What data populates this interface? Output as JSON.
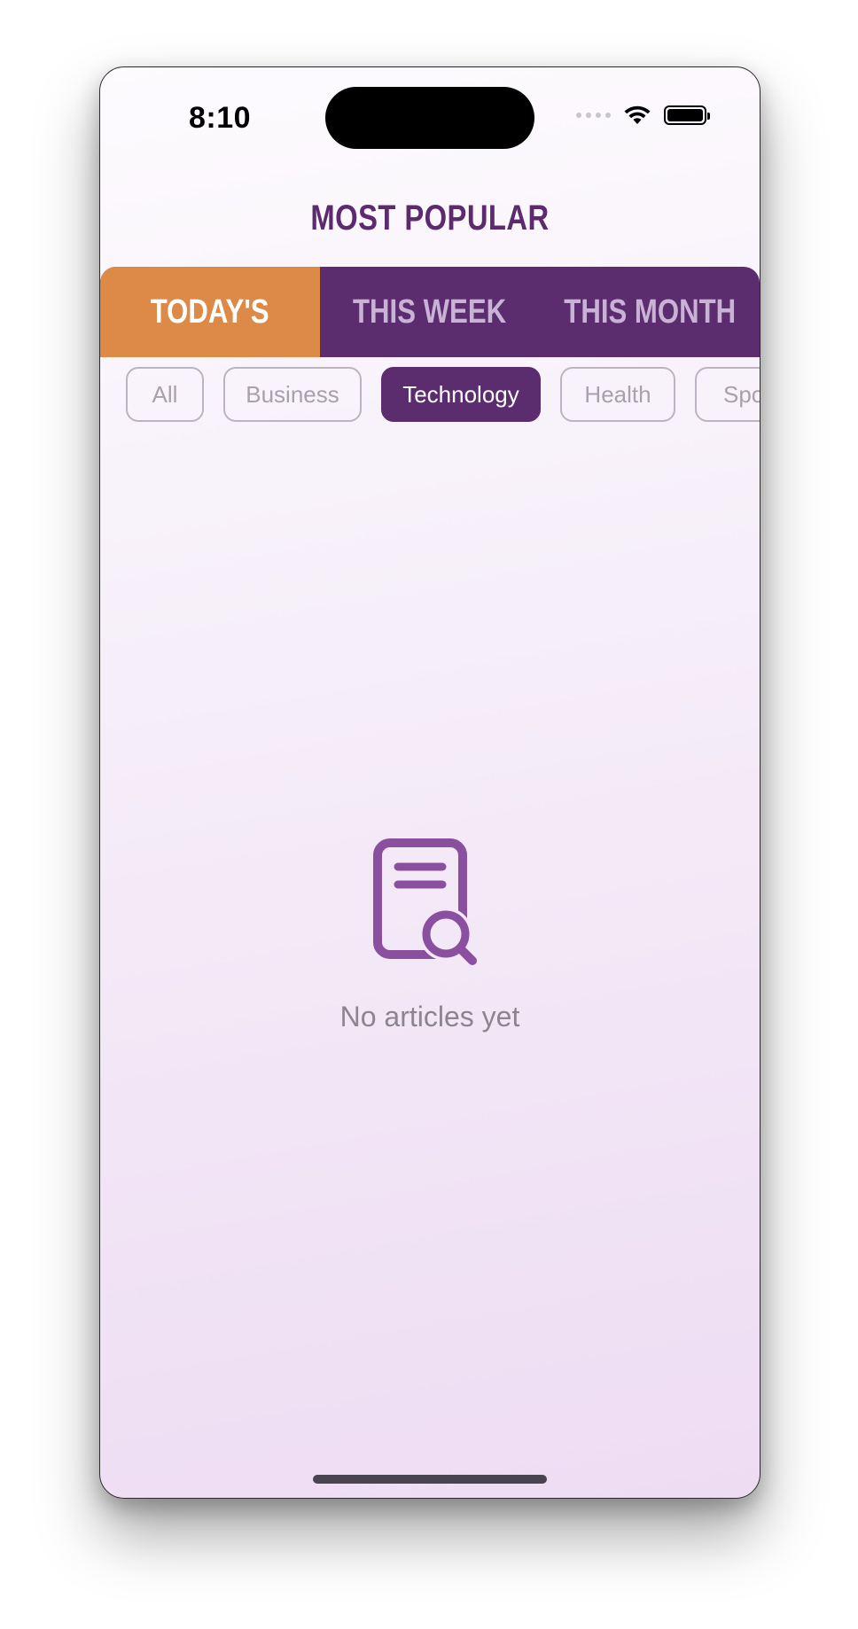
{
  "status_bar": {
    "time": "8:10"
  },
  "header": {
    "title": "MOST POPULAR"
  },
  "period_tabs": [
    {
      "label": "TODAY'S",
      "active": true
    },
    {
      "label": "THIS WEEK",
      "active": false
    },
    {
      "label": "THIS MONTH",
      "active": false
    }
  ],
  "categories": [
    {
      "label": "All",
      "active": false
    },
    {
      "label": "Business",
      "active": false
    },
    {
      "label": "Technology",
      "active": true
    },
    {
      "label": "Health",
      "active": false
    },
    {
      "label": "Sports",
      "active": false
    }
  ],
  "empty_state": {
    "icon": "document-search-icon",
    "message": "No articles yet"
  },
  "colors": {
    "primary": "#5b2d6e",
    "accent": "#dd8a48",
    "icon": "#8a4f9e"
  }
}
